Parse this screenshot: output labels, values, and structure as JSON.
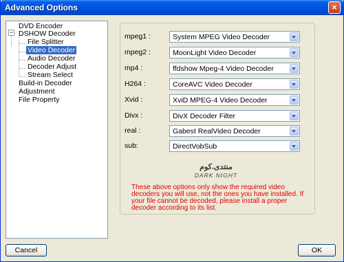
{
  "window": {
    "title": "Advanced Options",
    "close_glyph": "×"
  },
  "tree": {
    "items": [
      {
        "label": "DVD Encoder"
      },
      {
        "label": "DSHOW Decoder",
        "expander": "−"
      },
      {
        "label": "File Splitter"
      },
      {
        "label": "Video Decoder",
        "selected": true
      },
      {
        "label": "Audio Decoder"
      },
      {
        "label": "Decoder Adjust"
      },
      {
        "label": "Stream Select"
      },
      {
        "label": "Build-in Decoder"
      },
      {
        "label": "Adjustment"
      },
      {
        "label": "File Property"
      }
    ]
  },
  "decoders": {
    "rows": [
      {
        "label": "mpeg1 :",
        "value": "System MPEG Video Decoder"
      },
      {
        "label": "mpeg2 :",
        "value": "MoonLight Video Decoder"
      },
      {
        "label": "mp4 :",
        "value": "ffdshow Mpeg-4 Video Decoder"
      },
      {
        "label": "H264 :",
        "value": "CoreAVC Video Decoder"
      },
      {
        "label": "Xvid :",
        "value": "XviD MPEG-4 Video Decoder"
      },
      {
        "label": "Divx :",
        "value": "DivX Decoder Filter"
      },
      {
        "label": "real :",
        "value": "Gabest RealVideo Decoder"
      },
      {
        "label": "sub:",
        "value": "DirectVobSub"
      }
    ]
  },
  "logo": {
    "arabic": "منتدى.كوم",
    "latin": "DARK NIGHT"
  },
  "notice": "These above options only show the required video decoders you will use, not the ones you have installed. If your file cannot be decoded, please install a proper decoder according to its list.",
  "buttons": {
    "cancel": "Cancel",
    "ok": "OK"
  },
  "colors": {
    "titlebar": "#0053e1",
    "selection": "#316ac5",
    "notice": "#e00000"
  }
}
